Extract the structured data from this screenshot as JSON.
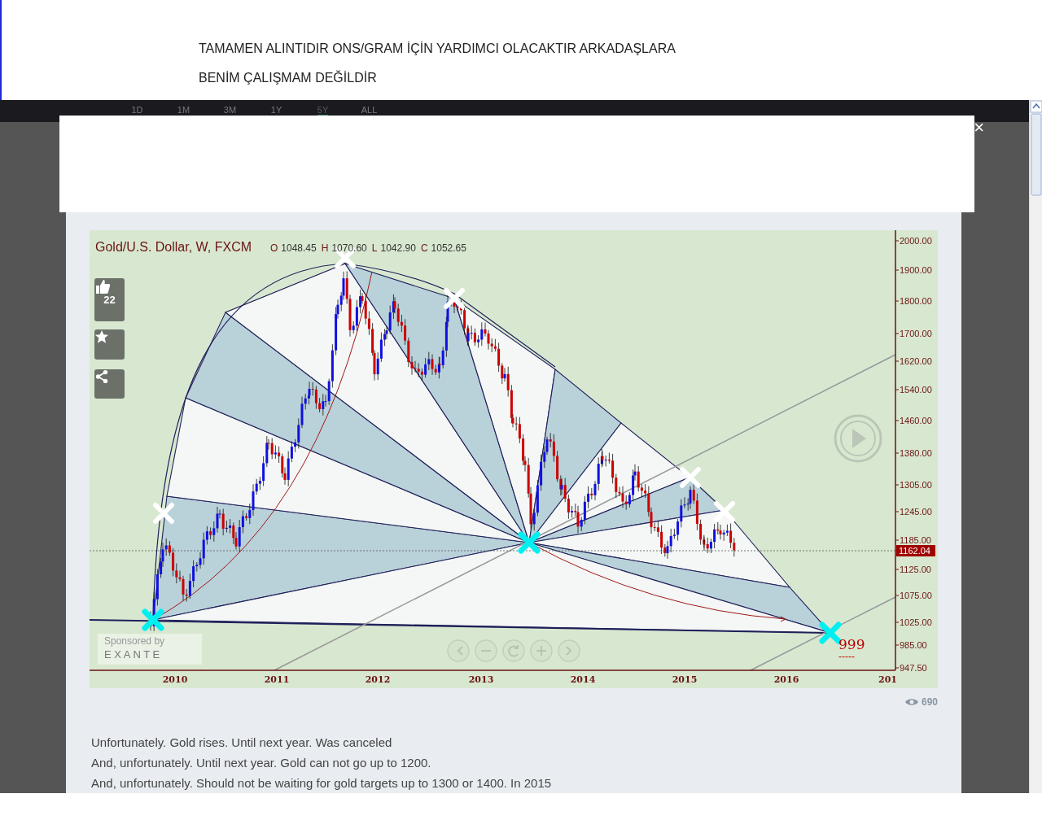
{
  "header_lines": [
    "TAMAMEN ALINTIDIR ONS/GRAM İÇİN YARDIMCI OLACAKTIR ARKADAŞLARA",
    "BENİM ÇALIŞMAM DEĞİLDİR"
  ],
  "range_tabs": [
    {
      "label": "1D",
      "selected": false
    },
    {
      "label": "1M",
      "selected": false
    },
    {
      "label": "3M",
      "selected": false
    },
    {
      "label": "1Y",
      "selected": false
    },
    {
      "label": "5Y",
      "selected": true
    },
    {
      "label": "ALL",
      "selected": false
    }
  ],
  "modal": {
    "close_label": "×"
  },
  "chart": {
    "symbol_title": "Gold/U.S. Dollar, W, FXCM",
    "ohlc": [
      {
        "key": "O",
        "value": "1048.45"
      },
      {
        "key": "H",
        "value": "1070.60"
      },
      {
        "key": "L",
        "value": "1042.90"
      },
      {
        "key": "C",
        "value": "1052.65"
      }
    ],
    "like_count": "22",
    "y_axis_labels": [
      "2000.00",
      "1900.00",
      "1800.00",
      "1700.00",
      "1620.00",
      "1540.00",
      "1460.00",
      "1380.00",
      "1305.00",
      "1245.00",
      "1185.00",
      "1125.00",
      "1075.00",
      "1025.00",
      "985.00",
      "947.50"
    ],
    "last_price": "1162.04",
    "x_axis_labels": [
      "2010",
      "2011",
      "2012",
      "2013",
      "2014",
      "2015",
      "2016",
      "201"
    ],
    "sponsor_label": "Sponsored by",
    "sponsor_name": "E X A N T E",
    "annotation": "999",
    "annotation_dashes": "-----"
  },
  "views": "690",
  "description_lines": [
    "Unfortunately. Gold rises. Until next year. Was canceled",
    "And, unfortunately. Until next year. Gold can not go up to 1200.",
    "And, unfortunately. Should not be waiting for gold targets up to 1300 or 1400. In 2015"
  ]
}
